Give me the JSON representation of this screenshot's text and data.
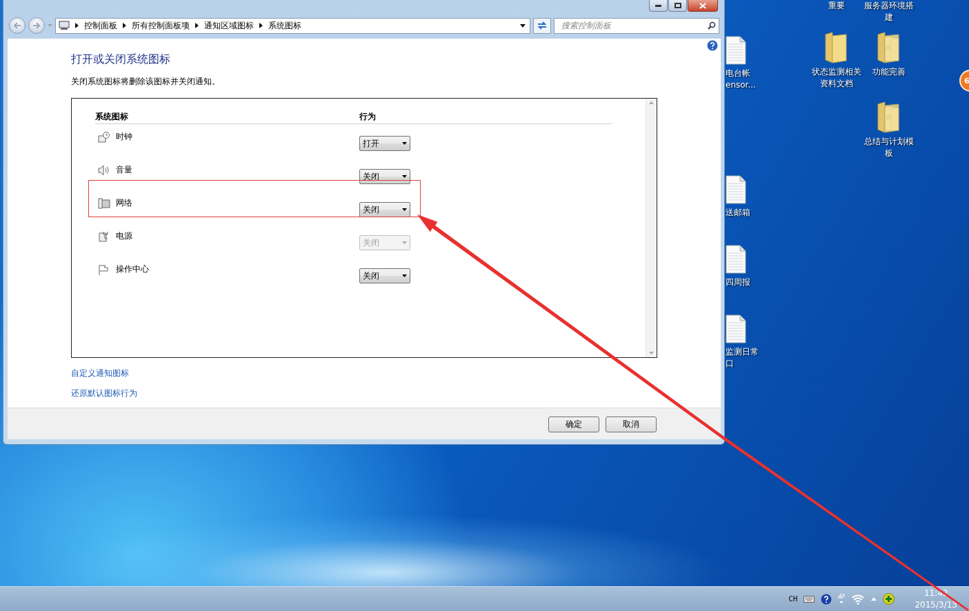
{
  "address_bar": {
    "breadcrumbs": [
      "控制面板",
      "所有控制面板项",
      "通知区域图标",
      "系统图标"
    ],
    "search": {
      "placeholder": "搜索控制面板"
    }
  },
  "page": {
    "title": "打开或关闭系统图标",
    "description": "关闭系统图标将删除该图标并关闭通知。",
    "table": {
      "columns": [
        "系统图标",
        "行为"
      ],
      "rows": [
        {
          "name": "时钟",
          "value": "打开",
          "disabled": false,
          "highlighted": false
        },
        {
          "name": "音量",
          "value": "关闭",
          "disabled": false,
          "highlighted": false
        },
        {
          "name": "网络",
          "value": "关闭",
          "disabled": false,
          "highlighted": true
        },
        {
          "name": "电源",
          "value": "关闭",
          "disabled": true,
          "highlighted": false
        },
        {
          "name": "操作中心",
          "value": "关闭",
          "disabled": false,
          "highlighted": false
        }
      ]
    },
    "links": [
      "自定义通知图标",
      "还原默认图标行为"
    ]
  },
  "footer_buttons": [
    "确定",
    "取消"
  ],
  "desktop_icons": [
    {
      "kind": "none",
      "label_lines": [
        "重要"
      ]
    },
    {
      "kind": "none",
      "label_lines": [
        "服务器环境搭",
        "建"
      ]
    },
    {
      "kind": "folder",
      "label_lines": [
        "状态监测相关",
        "资料文档"
      ]
    },
    {
      "kind": "folder-docs",
      "label_lines": [
        "功能完善"
      ]
    },
    {
      "kind": "folder-docs",
      "label_lines": [
        "总结与计划模",
        "板"
      ]
    },
    {
      "kind": "document",
      "label_lines": [
        "电台帐",
        "ensor..."
      ]
    },
    {
      "kind": "document",
      "label_lines": [
        "送邮箱"
      ]
    },
    {
      "kind": "document",
      "label_lines": [
        "四周报"
      ]
    },
    {
      "kind": "document",
      "label_lines": [
        "监测日常",
        "口"
      ]
    }
  ],
  "badge": {
    "text": "6"
  },
  "taskbar": {
    "language": "CH",
    "time": "11:42",
    "date": "2015/3/13"
  }
}
